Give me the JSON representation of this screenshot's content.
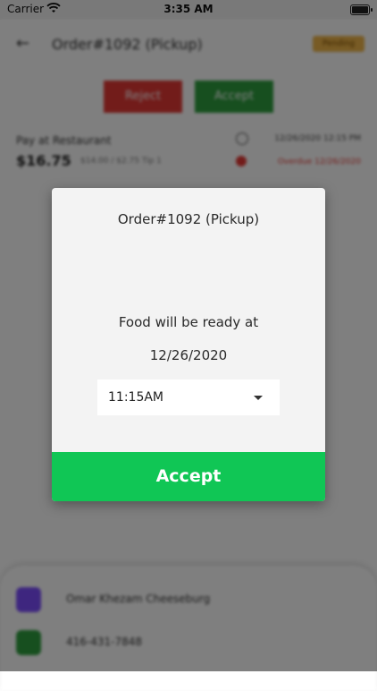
{
  "status_bar": {
    "carrier": "Carrier",
    "time": "3:35 AM",
    "icons": [
      "wifi-icon",
      "battery-icon"
    ]
  },
  "background": {
    "header": {
      "order_title": "Order#1092 (Pickup)",
      "status_badge": "Pending"
    },
    "actions": {
      "reject_label": "Reject",
      "accept_label": "Accept"
    },
    "payment": {
      "label": "Pay at Restaurant",
      "total": "$16.75",
      "breakdown": "$14.00 / $2.75 Tip 1",
      "scheduled": "12/26/2020 12:15 PM",
      "due": "Overdue 12/26/2020"
    },
    "customer": {
      "name": "Omar Khezam Cheeseburg",
      "phone": "416-431-7848"
    }
  },
  "dialog": {
    "title": "Order#1092 (Pickup)",
    "ready_text": "Food will be ready at",
    "date": "12/26/2020",
    "time_select": {
      "selected": "11:15AM"
    },
    "accept_label": "Accept"
  },
  "colors": {
    "accept_green": "#10c655",
    "reject_red": "#e53935",
    "dialog_bg": "#f3f3f3"
  }
}
